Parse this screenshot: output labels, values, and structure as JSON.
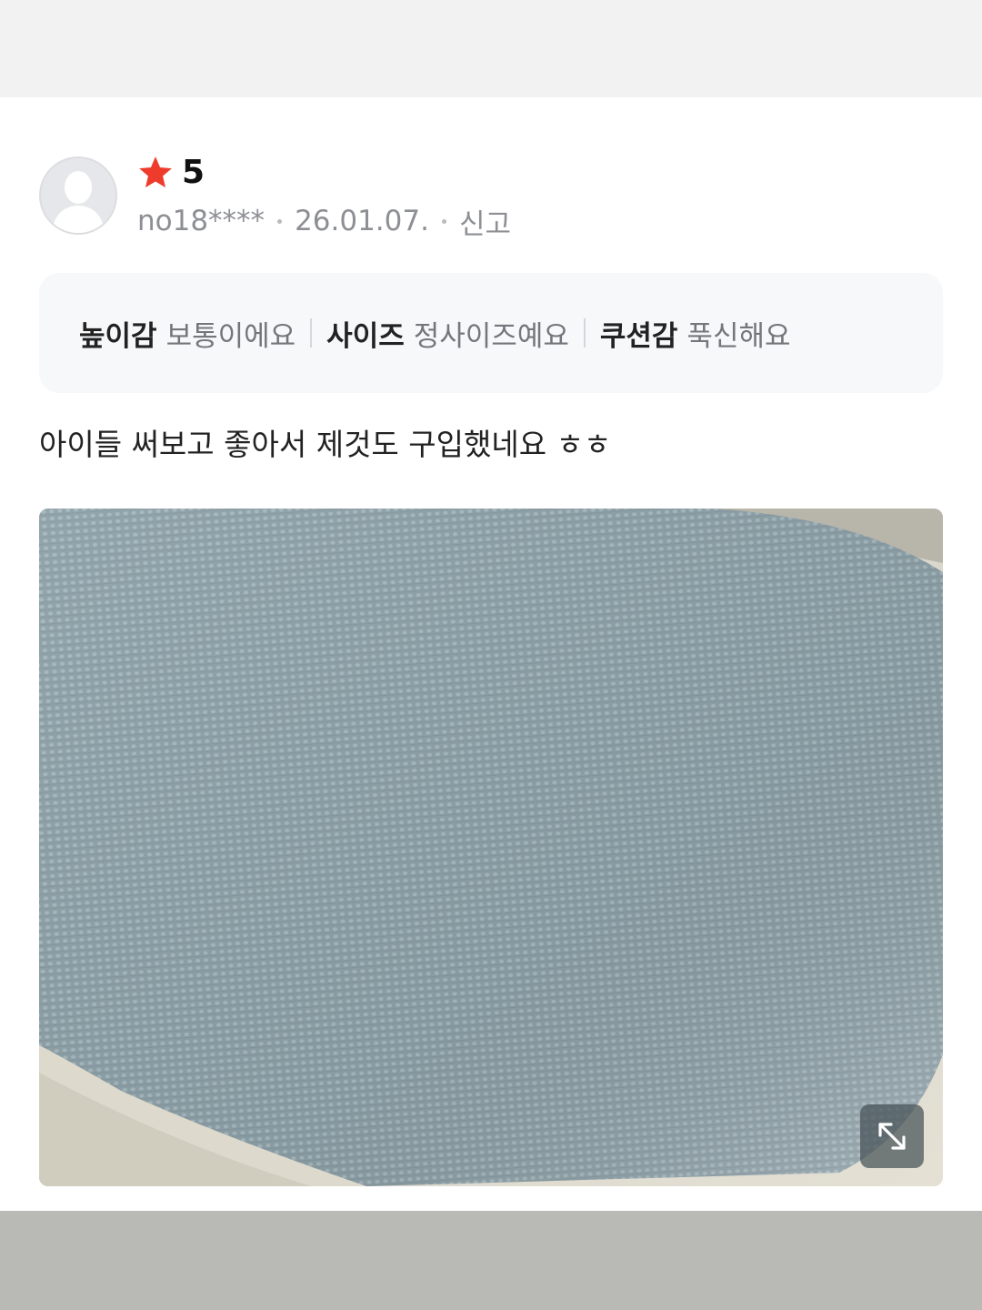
{
  "review": {
    "rating": "5",
    "user_id": "no18****",
    "date": "26.01.07.",
    "report_label": "신고",
    "attributes": [
      {
        "key": "높이감",
        "value": "보통이에요"
      },
      {
        "key": "사이즈",
        "value": "정사이즈예요"
      },
      {
        "key": "쿠션감",
        "value": "푹신해요"
      }
    ],
    "text": "아이들 써보고 좋아서 제것도 구입했네요 ㅎㅎ"
  },
  "icons": {
    "avatar": "default-user-avatar",
    "star": "star-icon",
    "expand": "expand-icon"
  },
  "colors": {
    "star": "#ef3b2c",
    "photo_fabric": "#8ea1a8"
  }
}
